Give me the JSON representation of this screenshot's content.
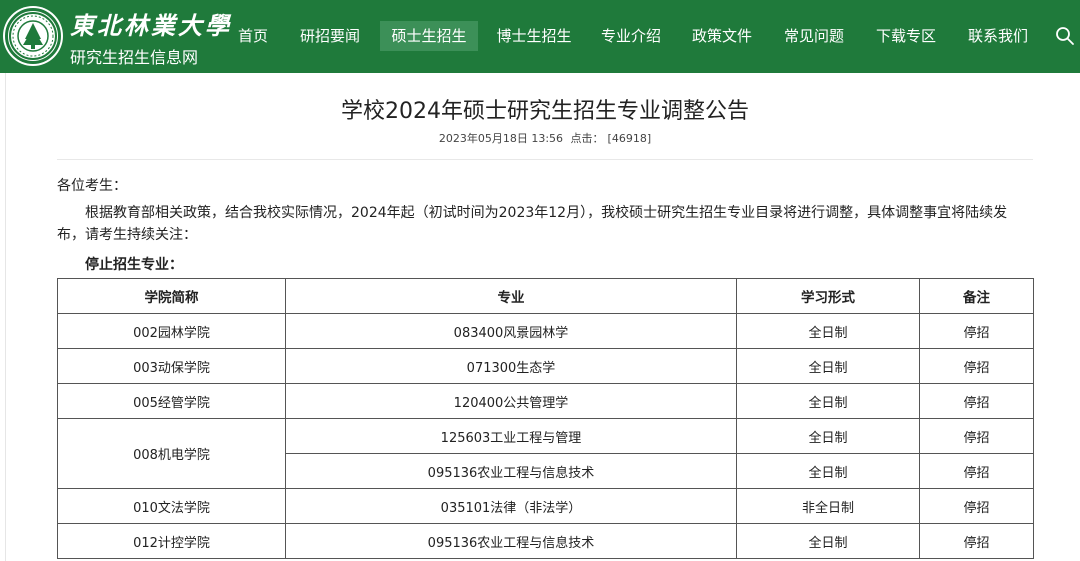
{
  "header": {
    "brand_title": "東北林業大學",
    "brand_subtitle": "研究生招生信息网",
    "nav": [
      "首页",
      "研招要闻",
      "硕士生招生",
      "博士生招生",
      "专业介绍",
      "政策文件",
      "常见问题",
      "下载专区",
      "联系我们"
    ],
    "active_nav": "硕士生招生",
    "colors": {
      "header_bg": "#1f7a3b",
      "active_bg": "#3c9058"
    }
  },
  "article": {
    "title": "学校2024年硕士研究生招生专业调整公告",
    "date": "2023年05月18日 13:56",
    "hits_label": "点击：",
    "hits": "[46918]",
    "greeting": "各位考生：",
    "body": "根据教育部相关政策，结合我校实际情况，2024年起（初试时间为2023年12月），我校硕士研究生招生专业目录将进行调整，具体调整事宜将陆续发布，请考生持续关注：",
    "subheading": "停止招生专业："
  },
  "table": {
    "headers": [
      "学院简称",
      "专业",
      "学习形式",
      "备注"
    ],
    "rows": [
      {
        "college": "002园林学院",
        "major": "083400风景园林学",
        "mode": "全日制",
        "note": "停招"
      },
      {
        "college": "003动保学院",
        "major": "071300生态学",
        "mode": "全日制",
        "note": "停招"
      },
      {
        "college": "005经管学院",
        "major": "120400公共管理学",
        "mode": "全日制",
        "note": "停招"
      },
      {
        "college": "008机电学院",
        "major": "125603工业工程与管理",
        "mode": "全日制",
        "note": "停招"
      },
      {
        "college": "",
        "major": "095136农业工程与信息技术",
        "mode": "全日制",
        "note": "停招"
      },
      {
        "college": "010文法学院",
        "major": "035101法律（非法学）",
        "mode": "非全日制",
        "note": "停招"
      },
      {
        "college": "012计控学院",
        "major": "095136农业工程与信息技术",
        "mode": "全日制",
        "note": "停招"
      }
    ]
  }
}
